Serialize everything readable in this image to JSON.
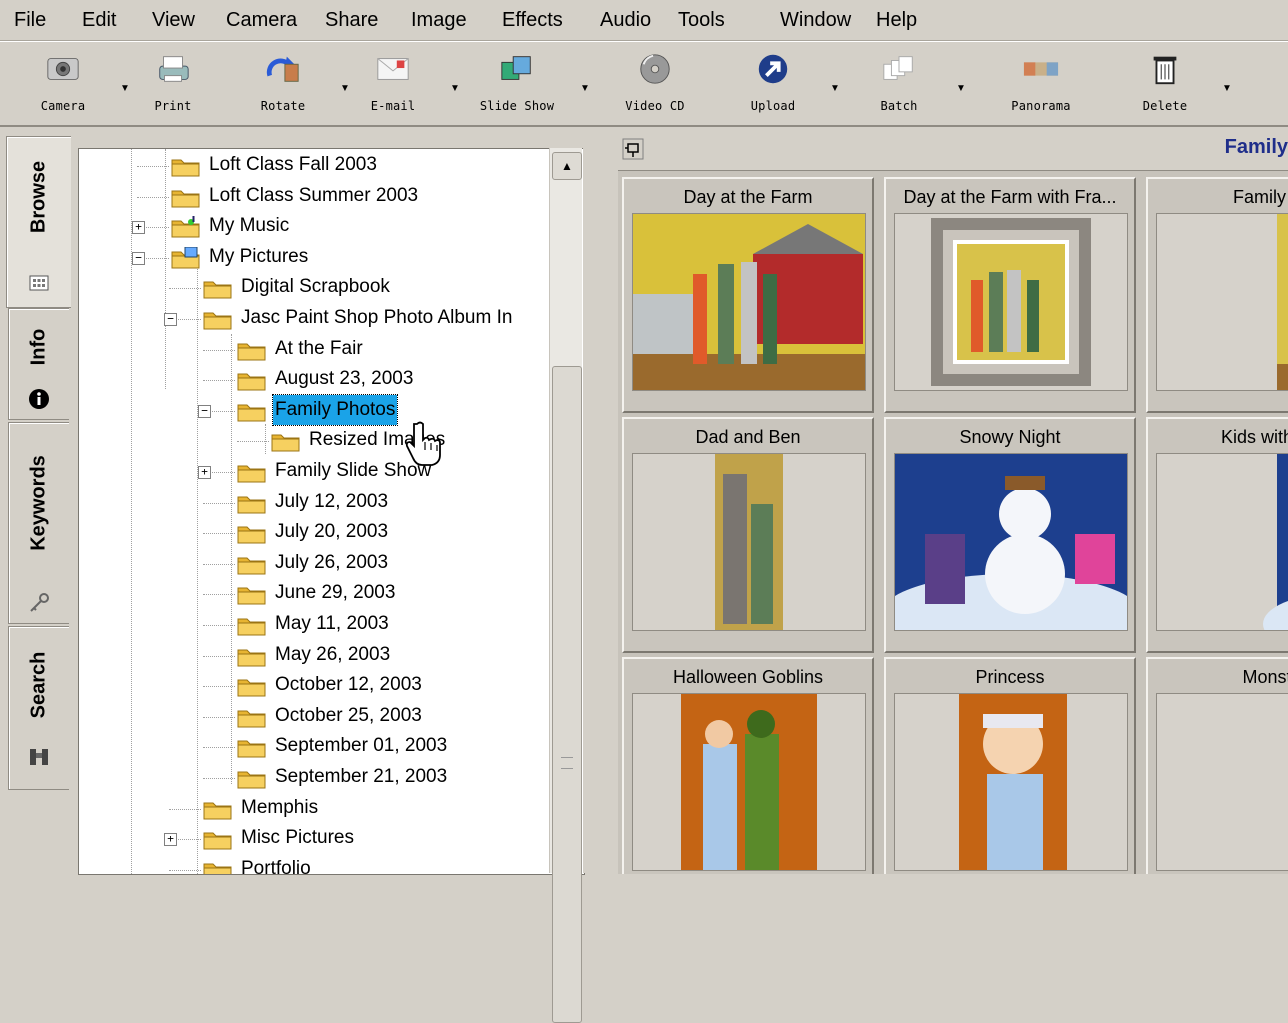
{
  "menu": [
    "File",
    "Edit",
    "View",
    "Camera",
    "Share",
    "Image",
    "Effects",
    "Audio",
    "Tools",
    "Window",
    "Help"
  ],
  "toolbar": [
    {
      "label": "Camera",
      "icon": "camera-icon",
      "dropdown": true
    },
    {
      "label": "Print",
      "icon": "printer-icon",
      "dropdown": false
    },
    {
      "label": "Rotate",
      "icon": "rotate-icon",
      "dropdown": true
    },
    {
      "label": "E-mail",
      "icon": "email-icon",
      "dropdown": true
    },
    {
      "label": "Slide Show",
      "icon": "slideshow-icon",
      "dropdown": true
    },
    {
      "label": "Video CD",
      "icon": "cd-icon",
      "dropdown": false
    },
    {
      "label": "Upload",
      "icon": "upload-icon",
      "dropdown": true
    },
    {
      "label": "Batch",
      "icon": "batch-icon",
      "dropdown": true
    },
    {
      "label": "Panorama",
      "icon": "panorama-icon",
      "dropdown": false
    },
    {
      "label": "Delete",
      "icon": "trash-icon",
      "dropdown": true
    }
  ],
  "sidetabs": {
    "browse": "Browse",
    "info": "Info",
    "keywords": "Keywords",
    "search": "Search"
  },
  "tree": [
    {
      "label": "Loft Class Fall 2003",
      "level": 0,
      "toggle": ""
    },
    {
      "label": "Loft Class Summer 2003",
      "level": 0,
      "toggle": ""
    },
    {
      "label": "My Music",
      "level": 0,
      "toggle": "+",
      "icon": "music-folder-icon"
    },
    {
      "label": "My Pictures",
      "level": 0,
      "toggle": "−",
      "icon": "pictures-folder-icon"
    },
    {
      "label": "Digital Scrapbook",
      "level": 1,
      "toggle": ""
    },
    {
      "label": "Jasc Paint Shop Photo Album In",
      "level": 1,
      "toggle": "−"
    },
    {
      "label": "At the Fair",
      "level": 2,
      "toggle": ""
    },
    {
      "label": "August 23, 2003",
      "level": 2,
      "toggle": ""
    },
    {
      "label": "Family Photos",
      "level": 2,
      "toggle": "−",
      "selected": true
    },
    {
      "label": "Resized Images",
      "level": 3,
      "toggle": ""
    },
    {
      "label": "Family Slide Show",
      "level": 2,
      "toggle": "+"
    },
    {
      "label": "July 12, 2003",
      "level": 2,
      "toggle": ""
    },
    {
      "label": "July 20, 2003",
      "level": 2,
      "toggle": ""
    },
    {
      "label": "July 26, 2003",
      "level": 2,
      "toggle": ""
    },
    {
      "label": "June 29, 2003",
      "level": 2,
      "toggle": ""
    },
    {
      "label": "May 11, 2003",
      "level": 2,
      "toggle": ""
    },
    {
      "label": "May 26, 2003",
      "level": 2,
      "toggle": ""
    },
    {
      "label": "October 12, 2003",
      "level": 2,
      "toggle": ""
    },
    {
      "label": "October 25, 2003",
      "level": 2,
      "toggle": ""
    },
    {
      "label": "September 01, 2003",
      "level": 2,
      "toggle": ""
    },
    {
      "label": "September 21, 2003",
      "level": 2,
      "toggle": ""
    },
    {
      "label": "Memphis",
      "level": 1,
      "toggle": ""
    },
    {
      "label": "Misc Pictures",
      "level": 1,
      "toggle": "+"
    },
    {
      "label": "Portfolio",
      "level": 1,
      "toggle": ""
    }
  ],
  "right": {
    "folder_title": "Family",
    "thumbnails": [
      {
        "caption": "Day at the Farm",
        "scene": "farm"
      },
      {
        "caption": "Day at the Farm with Fra...",
        "scene": "farm-framed"
      },
      {
        "caption": "Family on",
        "scene": "farm-partial"
      },
      {
        "caption": "Dad and Ben",
        "scene": "dad"
      },
      {
        "caption": "Snowy Night",
        "scene": "snow"
      },
      {
        "caption": "Kids with the",
        "scene": "snow-partial"
      },
      {
        "caption": "Halloween Goblins",
        "scene": "pumpkins"
      },
      {
        "caption": "Princess",
        "scene": "princess"
      },
      {
        "caption": "Monste",
        "scene": "monster"
      }
    ]
  },
  "colors": {
    "chrome": "#d4d0c8",
    "selection": "#1aa3e8",
    "folder": "#f3c846",
    "title": "#1f2e8a"
  }
}
